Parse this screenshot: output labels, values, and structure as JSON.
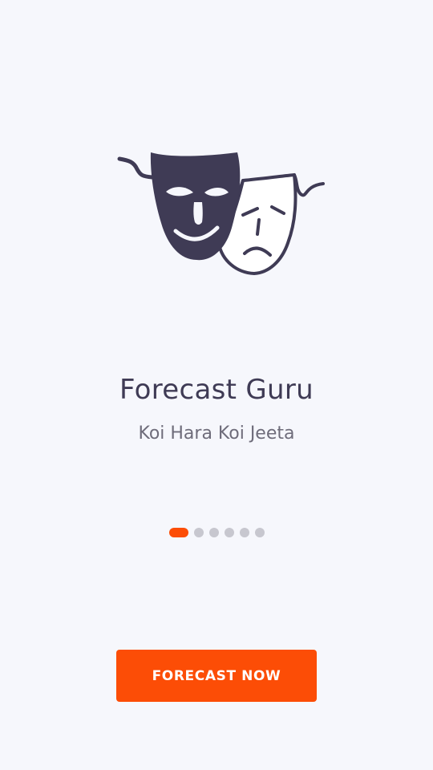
{
  "hero": {
    "icon": "theater-masks-icon"
  },
  "app": {
    "title": "Forecast Guru",
    "tagline": "Koi Hara Koi Jeeta"
  },
  "pagination": {
    "total": 6,
    "current": 1
  },
  "cta": {
    "label": "FORECAST NOW"
  },
  "colors": {
    "background": "#f6f7fc",
    "accent": "#fc4d06",
    "ink": "#3f3b55",
    "muted": "#6e6c7a",
    "dot_inactive": "#c7c7cf"
  }
}
